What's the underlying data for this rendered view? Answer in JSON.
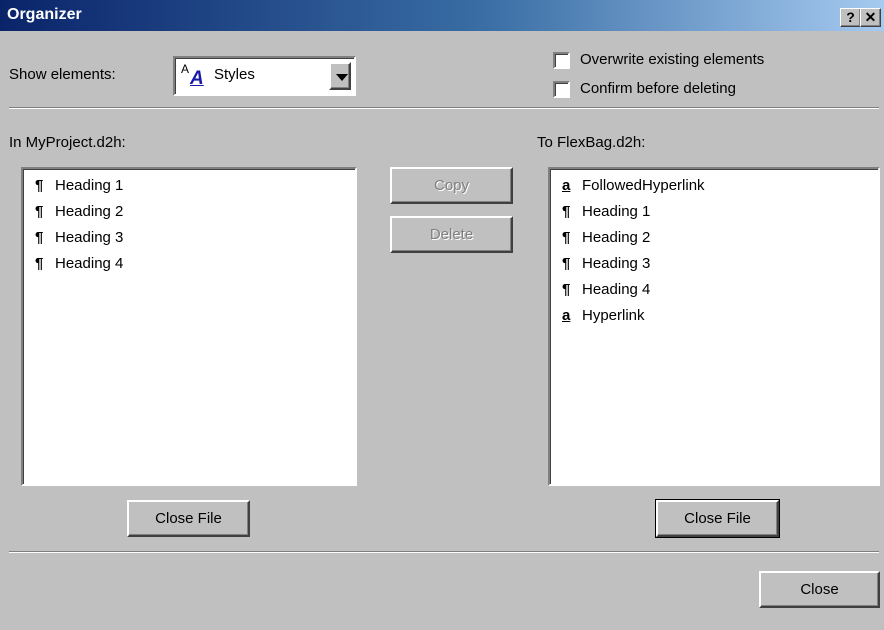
{
  "window": {
    "title": "Organizer",
    "help_label": "?",
    "close_label": "✕"
  },
  "show_elements": {
    "label": "Show elements:",
    "value": "Styles",
    "icon_sup": "A",
    "icon_main": "A"
  },
  "options": {
    "overwrite_label": "Overwrite existing elements",
    "overwrite_checked": false,
    "confirm_label": "Confirm before deleting",
    "confirm_checked": false
  },
  "left": {
    "label": "In MyProject.d2h:",
    "items": [
      {
        "glyph": "¶",
        "text": "Heading 1"
      },
      {
        "glyph": "¶",
        "text": "Heading 2"
      },
      {
        "glyph": "¶",
        "text": "Heading 3"
      },
      {
        "glyph": "¶",
        "text": "Heading 4"
      }
    ],
    "close_file_label": "Close File"
  },
  "right": {
    "label": "To FlexBag.d2h:",
    "items": [
      {
        "glyph": "a",
        "text": "FollowedHyperlink"
      },
      {
        "glyph": "¶",
        "text": "Heading 1"
      },
      {
        "glyph": "¶",
        "text": "Heading 2"
      },
      {
        "glyph": "¶",
        "text": "Heading 3"
      },
      {
        "glyph": "¶",
        "text": "Heading 4"
      },
      {
        "glyph": "a",
        "text": "Hyperlink"
      }
    ],
    "close_file_label": "Close File"
  },
  "actions": {
    "copy_label": "Copy",
    "delete_label": "Delete",
    "close_label": "Close"
  }
}
